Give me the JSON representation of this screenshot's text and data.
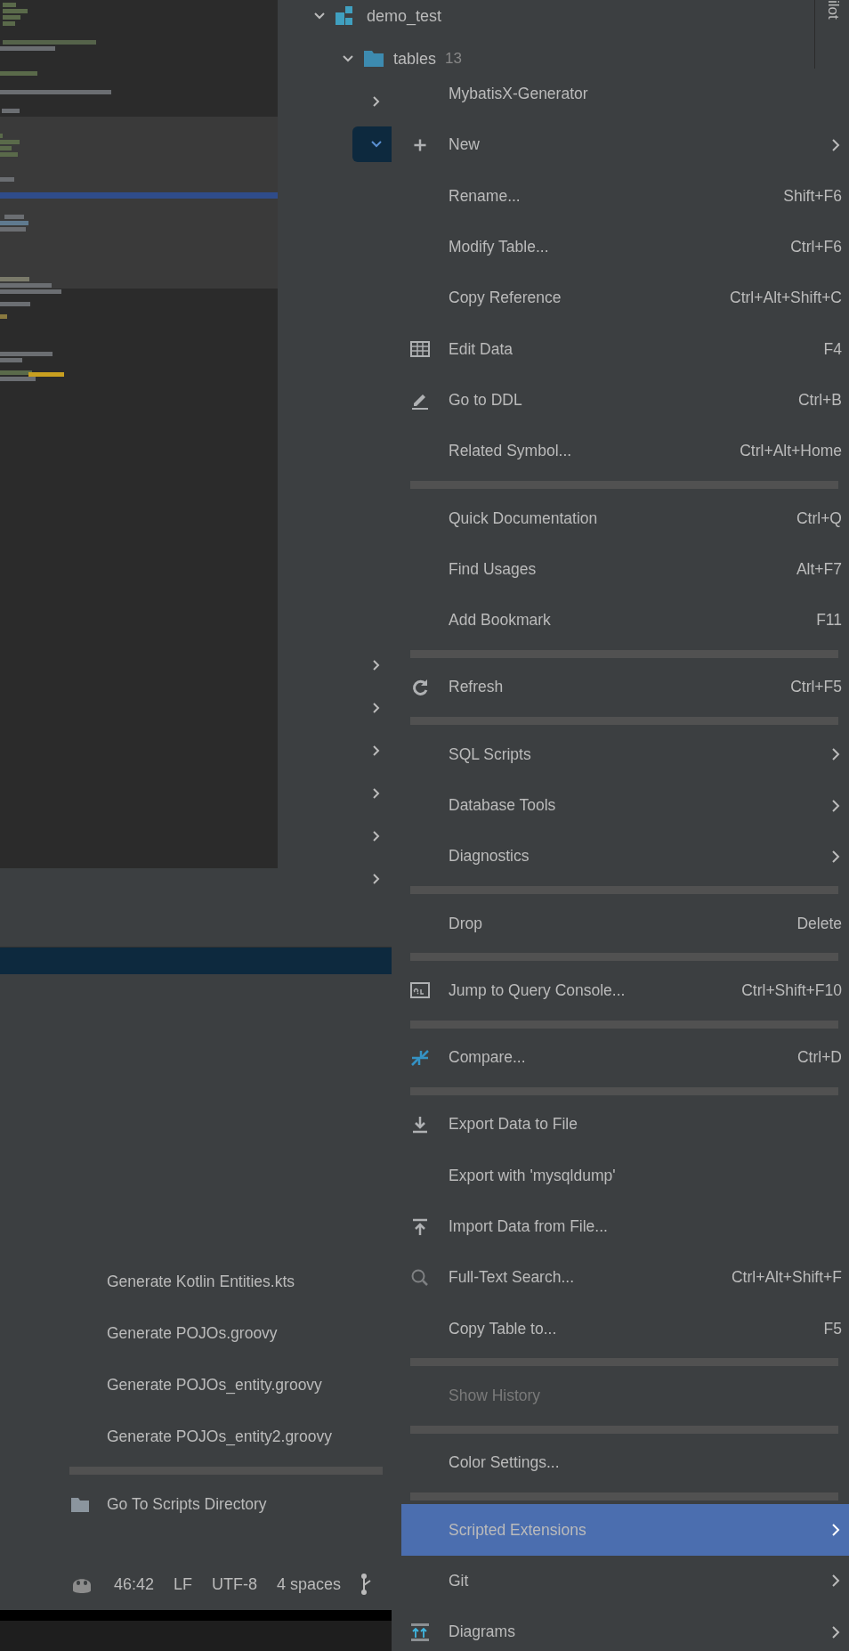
{
  "tree": {
    "items": [
      {
        "label": "demo_test",
        "expanded": true,
        "selected": false,
        "children": [
          {
            "label": "tables",
            "count": "13",
            "expanded": true,
            "selected": false,
            "children": [
              {
                "expanded": false,
                "selected": false
              },
              {
                "expanded": true,
                "selected": true
              },
              {
                "expanded": false,
                "selected": false
              },
              {
                "expanded": false,
                "selected": false
              },
              {
                "expanded": false,
                "selected": false
              },
              {
                "expanded": false,
                "selected": false
              },
              {
                "expanded": false,
                "selected": false
              },
              {
                "expanded": false,
                "selected": false
              }
            ]
          }
        ]
      }
    ]
  },
  "side_strip": {
    "label": "ilot"
  },
  "context_menu": {
    "items": [
      {
        "kind": "item",
        "label": "MybatisX-Generator",
        "selected": false,
        "disabled": false,
        "submenu": false
      },
      {
        "kind": "item",
        "label": "New",
        "selected": false,
        "disabled": false,
        "submenu": true
      },
      {
        "kind": "item",
        "label": "Rename...",
        "shortcut": "Shift+F6",
        "selected": false,
        "disabled": false,
        "submenu": false
      },
      {
        "kind": "item",
        "label": "Modify Table...",
        "shortcut": "Ctrl+F6",
        "selected": false,
        "disabled": false,
        "submenu": false
      },
      {
        "kind": "item",
        "label": "Copy Reference",
        "shortcut": "Ctrl+Alt+Shift+C",
        "selected": false,
        "disabled": false,
        "submenu": false
      },
      {
        "kind": "item",
        "label": "Edit Data",
        "shortcut": "F4",
        "selected": false,
        "disabled": false,
        "submenu": false
      },
      {
        "kind": "item",
        "label": "Go to DDL",
        "shortcut": "Ctrl+B",
        "selected": false,
        "disabled": false,
        "submenu": false
      },
      {
        "kind": "item",
        "label": "Related Symbol...",
        "shortcut": "Ctrl+Alt+Home",
        "selected": false,
        "disabled": false,
        "submenu": false
      },
      {
        "kind": "separator"
      },
      {
        "kind": "item",
        "label": "Quick Documentation",
        "shortcut": "Ctrl+Q",
        "selected": false,
        "disabled": false,
        "submenu": false
      },
      {
        "kind": "item",
        "label": "Find Usages",
        "shortcut": "Alt+F7",
        "selected": false,
        "disabled": false,
        "submenu": false
      },
      {
        "kind": "item",
        "label": "Add Bookmark",
        "shortcut": "F11",
        "selected": false,
        "disabled": false,
        "submenu": false
      },
      {
        "kind": "separator"
      },
      {
        "kind": "item",
        "label": "Refresh",
        "shortcut": "Ctrl+F5",
        "selected": false,
        "disabled": false,
        "submenu": false
      },
      {
        "kind": "separator"
      },
      {
        "kind": "item",
        "label": "SQL Scripts",
        "selected": false,
        "disabled": false,
        "submenu": true
      },
      {
        "kind": "item",
        "label": "Database Tools",
        "selected": false,
        "disabled": false,
        "submenu": true
      },
      {
        "kind": "item",
        "label": "Diagnostics",
        "selected": false,
        "disabled": false,
        "submenu": true
      },
      {
        "kind": "separator"
      },
      {
        "kind": "item",
        "label": "Drop",
        "shortcut": "Delete",
        "selected": false,
        "disabled": false,
        "submenu": false
      },
      {
        "kind": "separator"
      },
      {
        "kind": "item",
        "label": "Jump to Query Console...",
        "shortcut": "Ctrl+Shift+F10",
        "selected": false,
        "disabled": false,
        "submenu": false
      },
      {
        "kind": "separator"
      },
      {
        "kind": "item",
        "label": "Compare...",
        "shortcut": "Ctrl+D",
        "selected": false,
        "disabled": false,
        "submenu": false
      },
      {
        "kind": "separator"
      },
      {
        "kind": "item",
        "label": "Export Data to File",
        "selected": false,
        "disabled": false,
        "submenu": false
      },
      {
        "kind": "item",
        "label": "Export with 'mysqldump'",
        "selected": false,
        "disabled": false,
        "submenu": false
      },
      {
        "kind": "item",
        "label": "Import Data from File...",
        "selected": false,
        "disabled": false,
        "submenu": false
      },
      {
        "kind": "item",
        "label": "Full-Text Search...",
        "shortcut": "Ctrl+Alt+Shift+F",
        "selected": false,
        "disabled": false,
        "submenu": false
      },
      {
        "kind": "item",
        "label": "Copy Table to...",
        "shortcut": "F5",
        "selected": false,
        "disabled": false,
        "submenu": false
      },
      {
        "kind": "separator"
      },
      {
        "kind": "item",
        "label": "Show History",
        "selected": false,
        "disabled": true,
        "submenu": false
      },
      {
        "kind": "separator"
      },
      {
        "kind": "item",
        "label": "Color Settings...",
        "selected": false,
        "disabled": false,
        "submenu": false
      },
      {
        "kind": "separator"
      },
      {
        "kind": "item",
        "label": "Scripted Extensions",
        "selected": true,
        "disabled": false,
        "submenu": true
      },
      {
        "kind": "item",
        "label": "Git",
        "selected": false,
        "disabled": false,
        "submenu": true
      },
      {
        "kind": "item",
        "label": "Diagrams",
        "selected": false,
        "disabled": false,
        "submenu": true
      }
    ]
  },
  "submenu": {
    "items": [
      {
        "kind": "item",
        "label": "Generate Kotlin Entities.kts",
        "selected": false
      },
      {
        "kind": "item",
        "label": "Generate POJOs.groovy",
        "selected": false
      },
      {
        "kind": "item",
        "label": "Generate POJOs_entity.groovy",
        "selected": false
      },
      {
        "kind": "item",
        "label": "Generate POJOs_entity2.groovy",
        "selected": false
      },
      {
        "kind": "separator"
      },
      {
        "kind": "item",
        "label": "Go To Scripts Directory",
        "selected": false
      }
    ]
  },
  "status_bar": {
    "items": [
      "46:42",
      "LF",
      "UTF-8",
      "4 spaces"
    ]
  }
}
